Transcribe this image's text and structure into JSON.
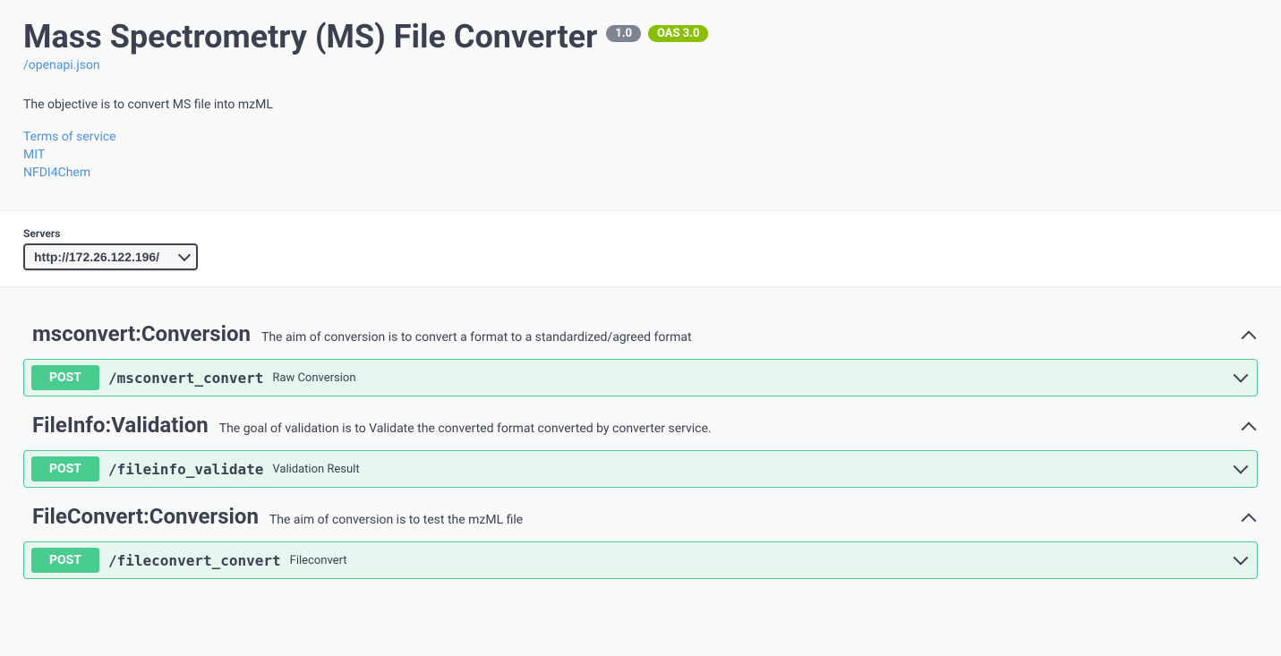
{
  "header": {
    "title": "Mass Spectrometry (MS) File Converter",
    "version": "1.0",
    "oas": "OAS 3.0",
    "spec_link": "/openapi.json",
    "description": "The objective is to convert MS file into mzML",
    "links": {
      "tos": "Terms of service",
      "license": "MIT",
      "contact": "NFDI4Chem"
    }
  },
  "servers": {
    "label": "Servers",
    "selected": "http://172.26.122.196/"
  },
  "tags": [
    {
      "name": "msconvert:Conversion",
      "description": "The aim of conversion is to convert a format to a standardized/agreed format",
      "endpoints": [
        {
          "method": "POST",
          "path": "/msconvert_convert",
          "summary": "Raw Conversion"
        }
      ]
    },
    {
      "name": "FileInfo:Validation",
      "description": "The goal of validation is to Validate the converted format converted by converter service.",
      "endpoints": [
        {
          "method": "POST",
          "path": "/fileinfo_validate",
          "summary": "Validation Result"
        }
      ]
    },
    {
      "name": "FileConvert:Conversion",
      "description": "The aim of conversion is to test the mzML file",
      "endpoints": [
        {
          "method": "POST",
          "path": "/fileconvert_convert",
          "summary": "Fileconvert"
        }
      ]
    }
  ]
}
